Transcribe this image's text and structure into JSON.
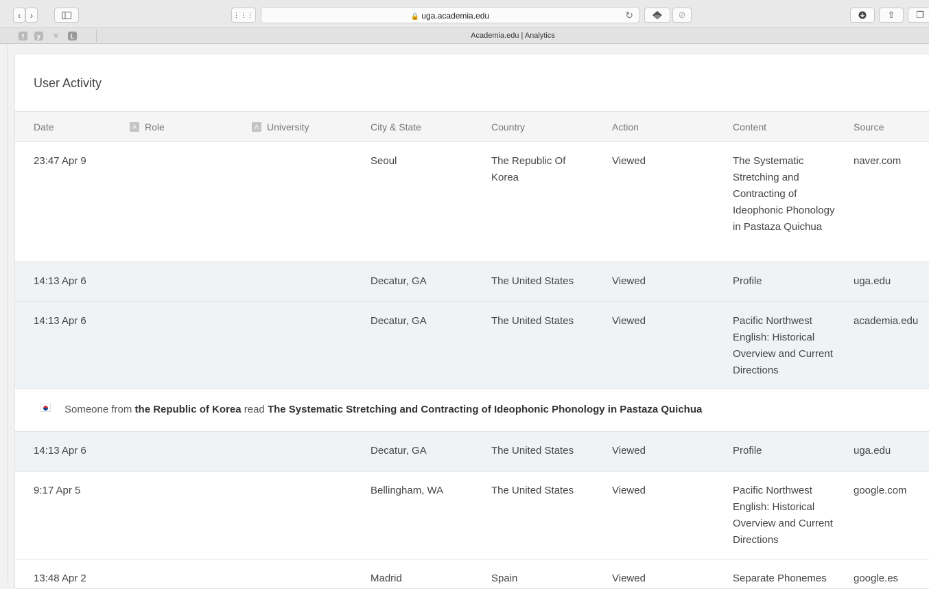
{
  "browser": {
    "url": "uga.academia.edu",
    "tab_title": "Academia.edu | Analytics",
    "favicons": [
      "f",
      "y",
      "❦",
      "L"
    ]
  },
  "card": {
    "title": "User Activity",
    "columns": {
      "date": "Date",
      "role": "Role",
      "university": "University",
      "city": "City & State",
      "country": "Country",
      "action": "Action",
      "content": "Content",
      "source": "Source"
    }
  },
  "rows": [
    {
      "date": "23:47 Apr 9",
      "city": "Seoul",
      "country": "The Republic Of Korea",
      "action": "Viewed",
      "content": "The Systematic Stretching and Contracting of Ideophonic Phonology in Pastaza Quichua",
      "source": "naver.com"
    },
    {
      "date": "14:13 Apr 6",
      "city": "Decatur, GA",
      "country": "The United States",
      "action": "Viewed",
      "content": "Profile",
      "source": "uga.edu"
    },
    {
      "date": "14:13 Apr 6",
      "city": "Decatur, GA",
      "country": "The United States",
      "action": "Viewed",
      "content": "Pacific Northwest English: Historical Overview and Current Directions",
      "source": "academia.edu"
    },
    {
      "date": "14:13 Apr 6",
      "city": "Decatur, GA",
      "country": "The United States",
      "action": "Viewed",
      "content": "Profile",
      "source": "uga.edu"
    },
    {
      "date": "9:17 Apr 5",
      "city": "Bellingham, WA",
      "country": "The United States",
      "action": "Viewed",
      "content": "Pacific Northwest English: Historical Overview and Current Directions",
      "source": "google.com"
    },
    {
      "date": "13:48 Apr 2",
      "city": "Madrid",
      "country": "Spain",
      "action": "Viewed",
      "content": "Separate Phonemes",
      "source": "google.es"
    }
  ],
  "notice": {
    "prefix": "Someone from ",
    "country": "the Republic of Korea",
    "middle": " read ",
    "work": "The Systematic Stretching and Contracting of Ideophonic Phonology in Pastaza Quichua"
  }
}
